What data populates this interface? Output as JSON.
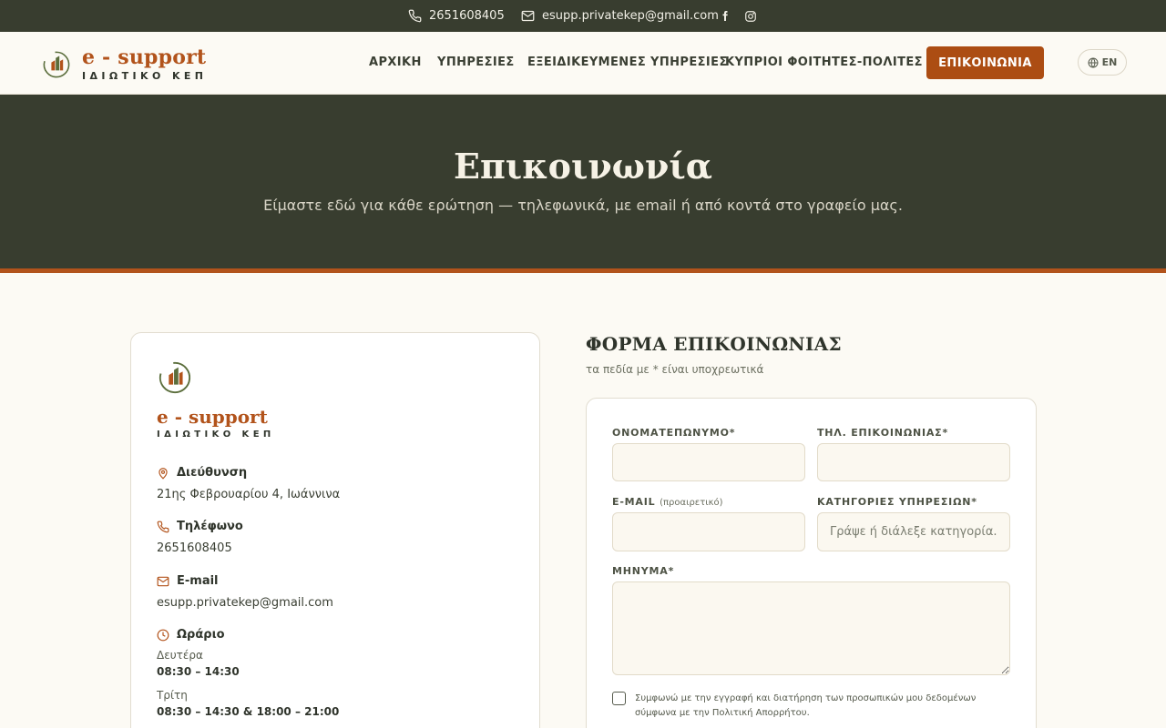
{
  "topbar": {
    "phone": "2651608405",
    "email": "esupp.privatekep@gmail.com",
    "social": [
      "facebook-icon",
      "instagram-icon"
    ]
  },
  "brand": {
    "title": "e - support",
    "subtitle": "ΙΔΙΩΤΙΚΟ ΚΕΠ"
  },
  "nav": {
    "items": [
      {
        "label": "ΑΡΧΙΚΗ"
      },
      {
        "label": "ΥΠΗΡΕΣΙΕΣ"
      },
      {
        "label": "ΕΞΕΙΔΙΚΕΥΜΕΝΕΣ ΥΠΗΡΕΣΙΕΣ"
      },
      {
        "label": "ΚΥΠΡΙΟΙ ΦΟΙΤΗΤΕΣ-ΠΟΛΙΤΕΣ"
      }
    ],
    "cta": "ΕΠΙΚΟΙΝΩΝΙΑ",
    "lang": "EN"
  },
  "hero": {
    "title": "Επικοινωνία",
    "subtitle": "Είμαστε εδώ για κάθε ερώτηση — τηλεφωνικά, με email ή από κοντά στο γραφείο μας."
  },
  "info": {
    "address_label": "Διεύθυνση",
    "address": "21ης Φεβρουαρίου 4, Ιωάννινα",
    "phone_label": "Τηλέφωνο",
    "phone": "2651608405",
    "email_label": "E-mail",
    "email": "esupp.privatekep@gmail.com",
    "hours_label": "Ωράριο",
    "hours": [
      {
        "day": "Δευτέρα",
        "time": "08:30 – 14:30"
      },
      {
        "day": "Τρίτη",
        "time": "08:30 – 14:30 & 18:00 – 21:00"
      }
    ]
  },
  "form": {
    "title": "ΦΟΡΜΑ ΕΠΙΚΟΙΝΩΝΙΑΣ",
    "note": "τα πεδία με * είναι υποχρεωτικά",
    "name_label": "ΟΝΟΜΑΤΕΠΩΝΥΜΟ*",
    "phone_label": "ΤΗΛ. ΕΠΙΚΟΙΝΩΝΙΑΣ*",
    "email_label": "E-MAIL",
    "email_optional": "(προαιρετικό)",
    "category_label": "ΚΑΤΗΓΟΡΙΕΣ ΥΠΗΡΕΣΙΩΝ*",
    "category_placeholder": "Γράψε ή διάλεξε κατηγορία...",
    "message_label": "ΜΗΝΥΜΑ*",
    "consent": "Συμφωνώ με την εγγραφή και διατήρηση των προσωπικών μου δεδομένων σύμφωνα με την Πολιτική Απορρήτου."
  },
  "colors": {
    "accent": "#ac4d13",
    "dark": "#383d2f",
    "background": "#fcfaf4"
  }
}
